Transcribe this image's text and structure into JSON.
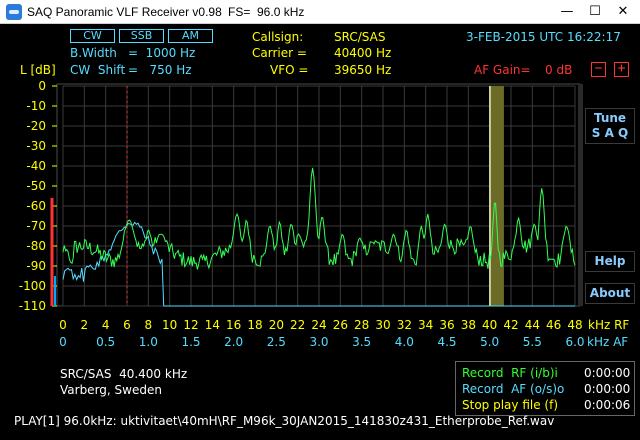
{
  "window": {
    "title": "SAQ Panoramic VLF Receiver v0.98",
    "fs": "FS=  96.0 kHz",
    "btn_min": "—",
    "btn_max": "☐",
    "btn_close": "✕",
    "app_icon": "receiver-app-icon"
  },
  "header": {
    "modes": [
      "CW",
      "SSB",
      "AM"
    ],
    "bwidth_label": "B.Width",
    "bwidth_value": "=  1000 Hz",
    "cwshift_label": "CW  Shift",
    "cwshift_value": "=   750 Hz",
    "callsign_label": "Callsign:",
    "callsign_value": "SRC/SAS",
    "carrier_label": "Carrier =",
    "carrier_value": "40400 Hz",
    "vfo_label": "VFO =",
    "vfo_value": "39650 Hz",
    "date": "3-FEB-2015 UTC 16:22:17",
    "af_gain_label": "AF Gain=",
    "af_gain_value": "0 dB",
    "af_minus": "−",
    "af_plus": "+"
  },
  "side_buttons": {
    "tune_l1": "Tune",
    "tune_l2": "S A Q",
    "help": "Help",
    "about": "About"
  },
  "spectrum": {
    "y_axis_title": "L [dB]",
    "y_ticks": [
      "0",
      "-10",
      "-20",
      "-30",
      "-40",
      "-50",
      "-60",
      "-70",
      "-80",
      "-90",
      "-100",
      "-110"
    ],
    "rf_ticks": [
      "0",
      "2",
      "4",
      "6",
      "8",
      "10",
      "12",
      "14",
      "16",
      "18",
      "20",
      "22",
      "24",
      "26",
      "28",
      "30",
      "32",
      "34",
      "36",
      "38",
      "40",
      "42",
      "44",
      "46",
      "48"
    ],
    "rf_unit": "kHz RF",
    "af_ticks": [
      "0",
      "0.5",
      "1.0",
      "1.5",
      "2.0",
      "2.5",
      "3.0",
      "3.5",
      "4.0",
      "4.5",
      "5.0",
      "5.5",
      "6.0"
    ],
    "af_unit": "kHz AF",
    "rf_marker_khz": 40.4,
    "af_marker_khz": 0.75,
    "colors": {
      "rf": "#33ff55",
      "af": "#55ddff",
      "band": "#6b6a26",
      "marker": "#ff3333",
      "level": "#ff3333"
    }
  },
  "station": {
    "line1": "SRC/SAS  40.400 kHz",
    "line2": "Varberg, Sweden"
  },
  "recording": {
    "record_rf_label": "Record  RF (i/b)i",
    "record_rf_time": "0:00:00",
    "record_af_label": "Record  AF (o/s)o",
    "record_af_time": "0:00:00",
    "stop_play_label": "Stop play file (f)",
    "stop_play_time": "0:00:06"
  },
  "status": "PLAY[1] 96.0kHz: uktivitaet\\40mH\\RF_M96k_30JAN2015_141830z431_Etherprobe_Ref.wav"
}
